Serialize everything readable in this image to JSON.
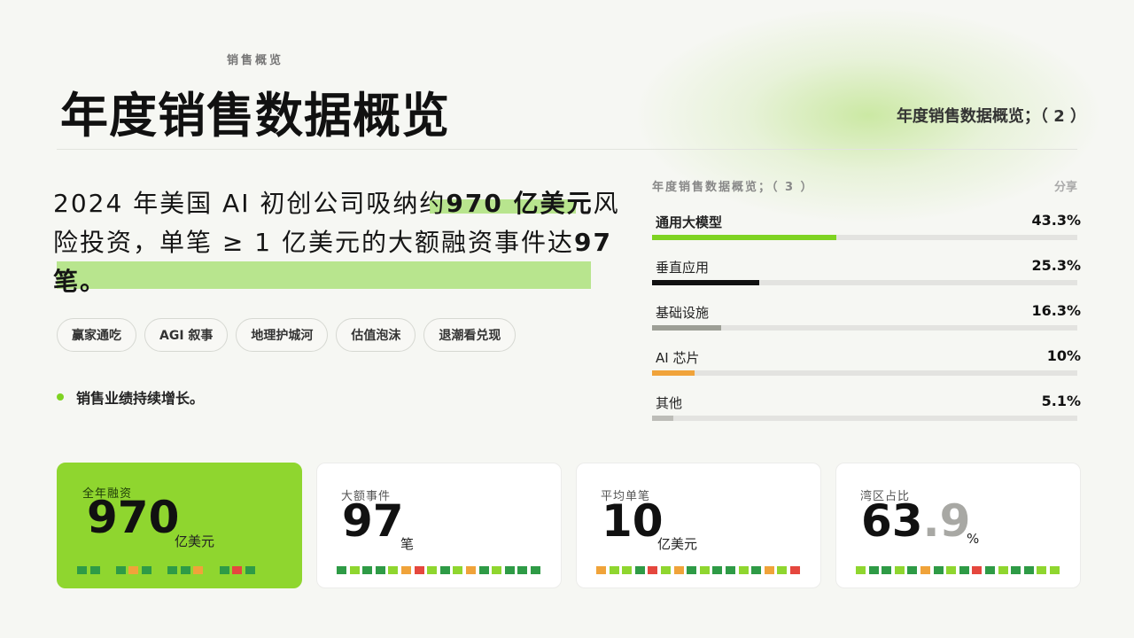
{
  "header": {
    "eyebrow": "销售概览",
    "title": "年度销售数据概览",
    "page_tag": "年度销售数据概览；（ 2 ）"
  },
  "headline": {
    "part1": "2024 年美国 AI 初创公司吸纳约",
    "highlight1": "970 亿美元",
    "part2": "风险投资，单笔 ≥ 1 亿美元的大额融资事件达",
    "highlight2": "97",
    "highlight3": "笔。"
  },
  "tags": [
    "赢家通吃",
    "AGI 叙事",
    "地理护城河",
    "估值泡沫",
    "退潮看兑现"
  ],
  "bullet": "销售业绩持续增长。",
  "share_panel": {
    "heading": "年度销售数据概览；（ 3 ）",
    "action": "分享",
    "items": [
      {
        "label": "通用大模型",
        "value": "43.3%",
        "share": 43.3,
        "color": "#7ed321"
      },
      {
        "label": "垂直应用",
        "value": "25.3%",
        "share": 25.3,
        "color": "#111111"
      },
      {
        "label": "基础设施",
        "value": "16.3%",
        "share": 16.3,
        "color": "#9d9f96"
      },
      {
        "label": "AI 芯片",
        "value": "10%",
        "share": 10,
        "color": "#f0a33a"
      },
      {
        "label": "其他",
        "value": "5.1%",
        "share": 5.1,
        "color": "#bdbdb8"
      }
    ]
  },
  "cards": [
    {
      "label": "全年融资",
      "big": "970",
      "decimal": "",
      "unit": "亿美元",
      "squares": [
        "#2e9b46",
        "#2e9b46",
        "",
        "#2e9b46",
        "#f0a33a",
        "#2e9b46",
        "",
        "#2e9b46",
        "#2e9b46",
        "#f0a33a",
        "",
        "#2e9b46",
        "#e5473e",
        "#2e9b46"
      ]
    },
    {
      "label": "大额事件",
      "big": "97",
      "decimal": "",
      "unit": "笔",
      "squares": [
        "#2e9b46",
        "#8fd62f",
        "#2e9b46",
        "#2e9b46",
        "#8fd62f",
        "#f0a33a",
        "#e5473e",
        "#8fd62f",
        "#2e9b46",
        "#8fd62f",
        "#f0a33a",
        "#2e9b46",
        "#8fd62f",
        "#2e9b46",
        "#2e9b46",
        "#2e9b46"
      ]
    },
    {
      "label": "平均单笔",
      "big": "10",
      "decimal": "",
      "unit": "亿美元",
      "squares": [
        "#f0a33a",
        "#8fd62f",
        "#8fd62f",
        "#2e9b46",
        "#e5473e",
        "#8fd62f",
        "#f0a33a",
        "#2e9b46",
        "#8fd62f",
        "#2e9b46",
        "#2e9b46",
        "#8fd62f",
        "#2e9b46",
        "#f0a33a",
        "#8fd62f",
        "#e5473e"
      ]
    },
    {
      "label": "湾区占比",
      "big": "63",
      "decimal": ".9",
      "unit": "%",
      "squares": [
        "#8fd62f",
        "#2e9b46",
        "#2e9b46",
        "#8fd62f",
        "#2e9b46",
        "#f0a33a",
        "#2e9b46",
        "#8fd62f",
        "#2e9b46",
        "#e5473e",
        "#2e9b46",
        "#8fd62f",
        "#2e9b46",
        "#2e9b46",
        "#8fd62f",
        "#8fd62f"
      ]
    }
  ]
}
